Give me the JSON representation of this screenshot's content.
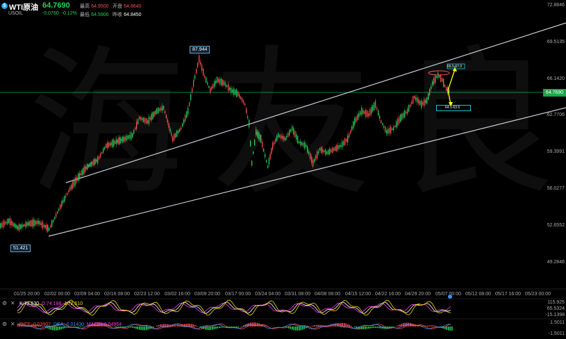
{
  "header": {
    "symbol": "WTI原油",
    "ticker": "USOIL",
    "last": "64.7690",
    "change": "-0.0760",
    "change_pct": "-0.12%",
    "high_label": "最高",
    "high": "64.9500",
    "open_label": "开盘",
    "open": "64.8640",
    "low_label": "最低",
    "low": "64.5900",
    "prev_label": "昨收",
    "prev": "64.8450"
  },
  "price_axis": [
    "72.8846",
    "69.5135",
    "66.1420",
    "62.7706",
    "59.3991",
    "56.0277",
    "52.6552",
    "49.2846"
  ],
  "current_price_tag": "64.7690",
  "callouts": {
    "high": "87.944",
    "low": "51.421"
  },
  "targets": {
    "up": "66.5-67.0",
    "down": "64.1-63.5"
  },
  "dates": [
    "01/25 20:00",
    "02/02 00:00",
    "02/09 04:00",
    "02/16 08:00",
    "02/23 12:00",
    "03/02 16:00",
    "03/09 20:00",
    "03/17 00:00",
    "03/24 04:00",
    "03/31 08:00",
    "04/08 08:00",
    "04/15 12:00",
    "04/22 16:00",
    "04/29 20:00",
    "05/07 00:00",
    "05/12 08:00",
    "05/17 16:00",
    "05/23 00:00"
  ],
  "kdj": {
    "k": "K:73.630",
    "d": "D:74.188",
    "j": "J:72.510",
    "axis_top": "115.925",
    "axis_mid": "65.5324",
    "axis_low": "-15.1398"
  },
  "macd": {
    "diff": "DIFF:-0.03907",
    "dea": "DEA:-0.01430",
    "macd": "MACD:-0.04954",
    "axis_top": "1.5011",
    "axis_low": "-1.5011"
  },
  "watermark": [
    "海",
    "友",
    "良"
  ],
  "colors": {
    "up": "#21d35a",
    "down": "#ff4d4d",
    "accent": "#1ea5e9",
    "arrow": "#ffff00"
  }
}
